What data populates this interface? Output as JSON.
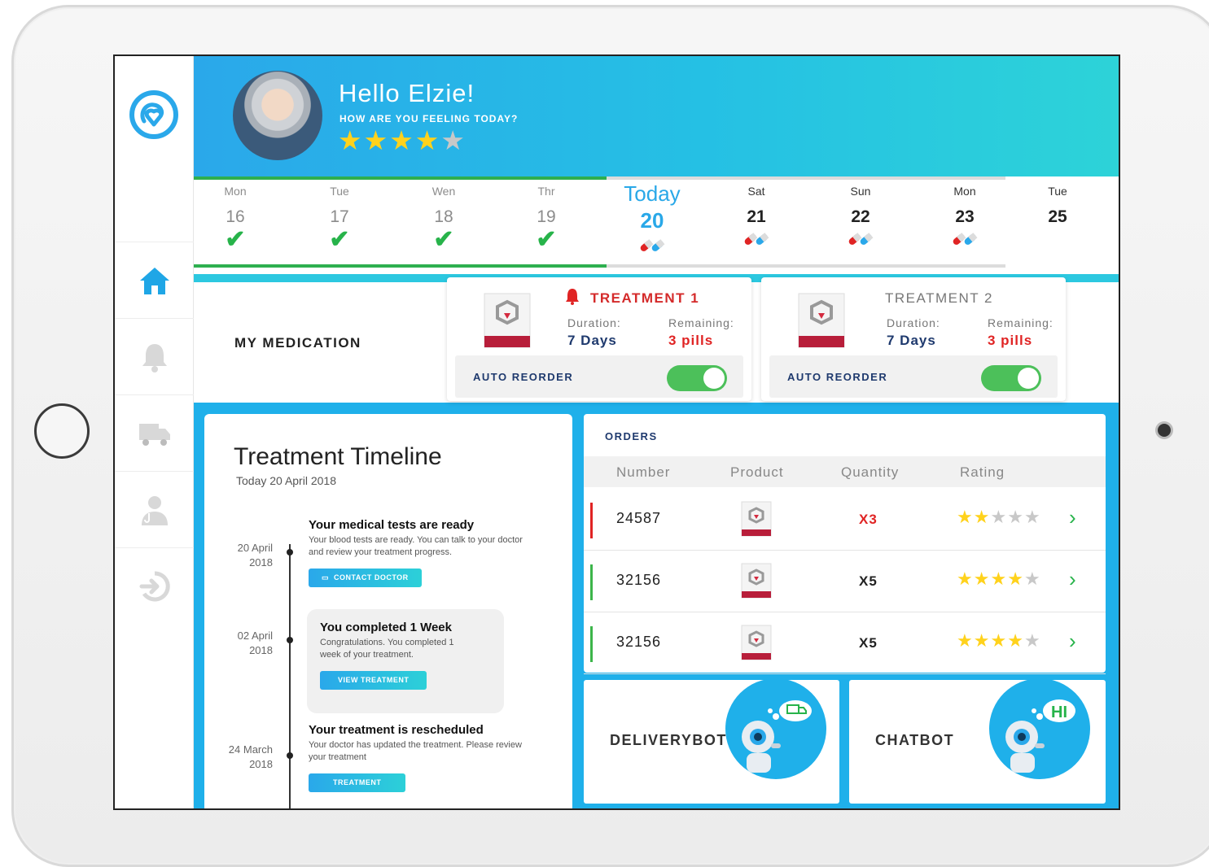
{
  "greeting": {
    "hello": "Hello Elzie!",
    "question": "HOW ARE YOU FEELING TODAY?",
    "rating": 4,
    "max_rating": 5
  },
  "week": [
    {
      "day": "Mon",
      "date": "16",
      "status": "done"
    },
    {
      "day": "Tue",
      "date": "17",
      "status": "done"
    },
    {
      "day": "Wen",
      "date": "18",
      "status": "done"
    },
    {
      "day": "Thr",
      "date": "19",
      "status": "done"
    },
    {
      "day": "Today",
      "date": "20",
      "status": "today"
    },
    {
      "day": "Sat",
      "date": "21",
      "status": "scheduled"
    },
    {
      "day": "Sun",
      "date": "22",
      "status": "scheduled"
    },
    {
      "day": "Mon",
      "date": "23",
      "status": "scheduled"
    },
    {
      "day": "Tue",
      "date": "25",
      "status": "none"
    }
  ],
  "medication": {
    "title": "MY MEDICATION",
    "treatments": [
      {
        "name": "TREATMENT 1",
        "alert": true,
        "duration_label": "Duration:",
        "duration": "7 Days",
        "remaining_label": "Remaining:",
        "remaining": "3 pills",
        "reorder_label": "AUTO REORDER",
        "auto_reorder": true
      },
      {
        "name": "TREATMENT 2",
        "alert": false,
        "duration_label": "Duration:",
        "duration": "7 Days",
        "remaining_label": "Remaining:",
        "remaining": "3 pills",
        "reorder_label": "AUTO REORDER",
        "auto_reorder": true
      }
    ]
  },
  "timeline": {
    "title": "Treatment Timeline",
    "subtitle": "Today 20 April 2018",
    "items": [
      {
        "date_line1": "20 April",
        "date_line2": "2018",
        "title": "Your medical tests are ready",
        "body": "Your blood tests are ready. You can talk to your doctor and review your treatment progress.",
        "button": "CONTACT DOCTOR"
      },
      {
        "date_line1": "02 April",
        "date_line2": "2018",
        "title": "You completed 1 Week",
        "body": "Congratulations. You completed 1 week of your treatment.",
        "button": "VIEW TREATMENT"
      },
      {
        "date_line1": "24 March",
        "date_line2": "2018",
        "title": "Your treatment is rescheduled",
        "body": "Your doctor has updated the treatment. Please review your treatment",
        "button": "TREATMENT"
      }
    ]
  },
  "orders": {
    "title": "ORDERS",
    "columns": [
      "Number",
      "Product",
      "Quantity",
      "Rating"
    ],
    "rows": [
      {
        "number": "24587",
        "quantity": "X3",
        "rating": 2,
        "flag_color": "#e02424",
        "qty_color": "#e02424"
      },
      {
        "number": "32156",
        "quantity": "X5",
        "rating": 4,
        "flag_color": "#3cb54a",
        "qty_color": "#222222"
      },
      {
        "number": "32156",
        "quantity": "X5",
        "rating": 4,
        "flag_color": "#3cb54a",
        "qty_color": "#222222"
      }
    ]
  },
  "bots": {
    "delivery": "DELIVERYBOT",
    "chat": "CHATBOT",
    "chat_bubble": "HI"
  },
  "colors": {
    "accent": "#1fb0ea",
    "success": "#27b34a",
    "alert": "#e02424",
    "navy": "#1f3a6e"
  },
  "nav_icons": [
    "home-icon",
    "bell-icon",
    "truck-icon",
    "doctor-icon",
    "logout-icon"
  ]
}
